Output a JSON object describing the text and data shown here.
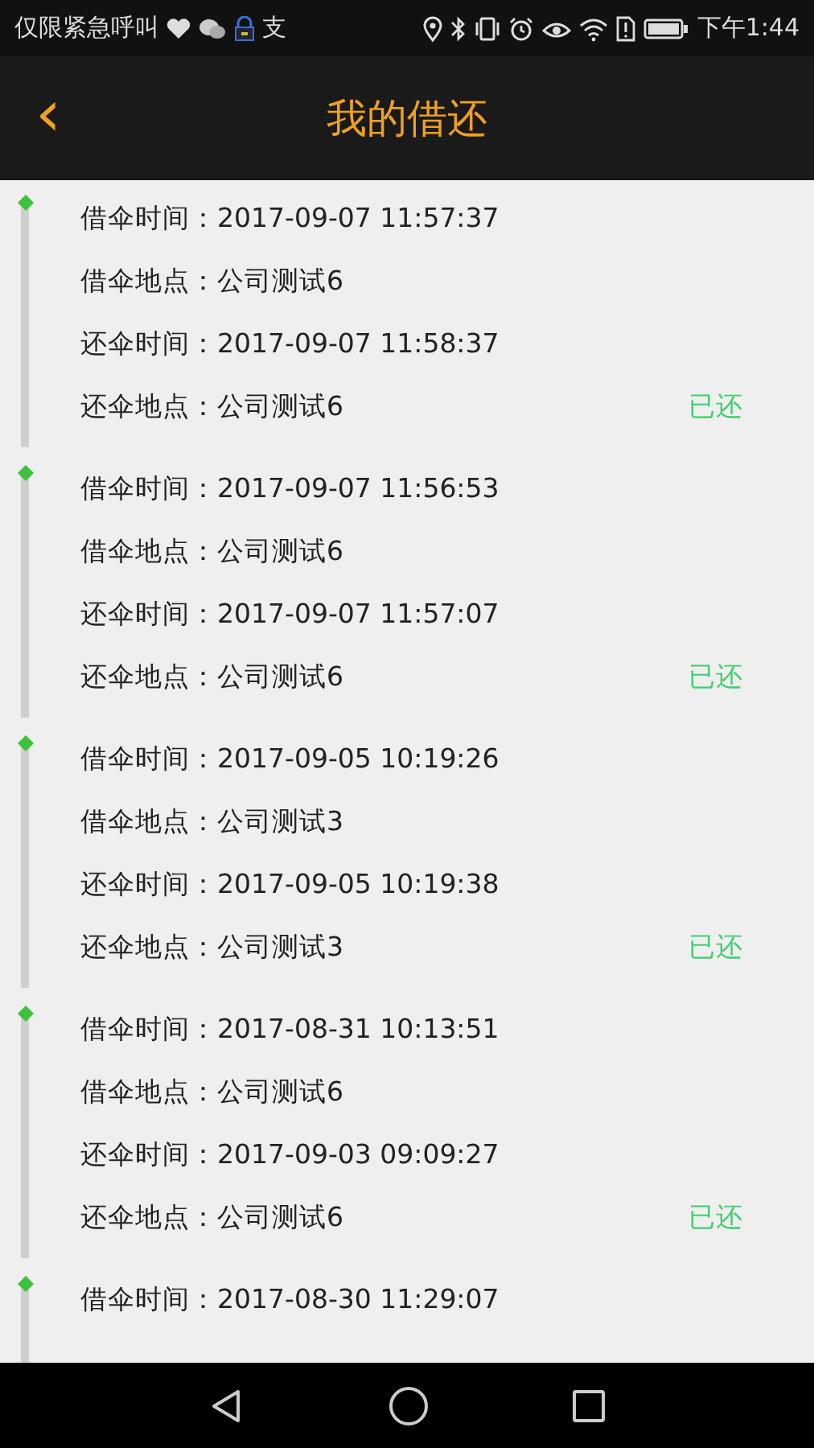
{
  "status_bar": {
    "carrier": "仅限紧急呼叫",
    "app_glyph": "支",
    "time": "下午1:44"
  },
  "header": {
    "back": "‹",
    "title": "我的借还"
  },
  "records": [
    {
      "lines": [
        {
          "label": "借伞时间：",
          "value": "2017-09-07 11:57:37"
        },
        {
          "label": "借伞地点：",
          "value": "公司测试6"
        },
        {
          "label": "还伞时间：",
          "value": "2017-09-07 11:58:37"
        },
        {
          "label": "还伞地点：",
          "value": "公司测试6"
        }
      ],
      "status": "已还"
    },
    {
      "lines": [
        {
          "label": "借伞时间：",
          "value": "2017-09-07 11:56:53"
        },
        {
          "label": "借伞地点：",
          "value": "公司测试6"
        },
        {
          "label": "还伞时间：",
          "value": "2017-09-07 11:57:07"
        },
        {
          "label": "还伞地点：",
          "value": "公司测试6"
        }
      ],
      "status": "已还"
    },
    {
      "lines": [
        {
          "label": "借伞时间：",
          "value": "2017-09-05 10:19:26"
        },
        {
          "label": "借伞地点：",
          "value": "公司测试3"
        },
        {
          "label": "还伞时间：",
          "value": "2017-09-05 10:19:38"
        },
        {
          "label": "还伞地点：",
          "value": "公司测试3"
        }
      ],
      "status": "已还"
    },
    {
      "lines": [
        {
          "label": "借伞时间：",
          "value": "2017-08-31 10:13:51"
        },
        {
          "label": "借伞地点：",
          "value": "公司测试6"
        },
        {
          "label": "还伞时间：",
          "value": "2017-09-03 09:09:27"
        },
        {
          "label": "还伞地点：",
          "value": "公司测试6"
        }
      ],
      "status": "已还"
    },
    {
      "lines": [
        {
          "label": "借伞时间：",
          "value": "2017-08-30 11:29:07"
        }
      ]
    }
  ]
}
